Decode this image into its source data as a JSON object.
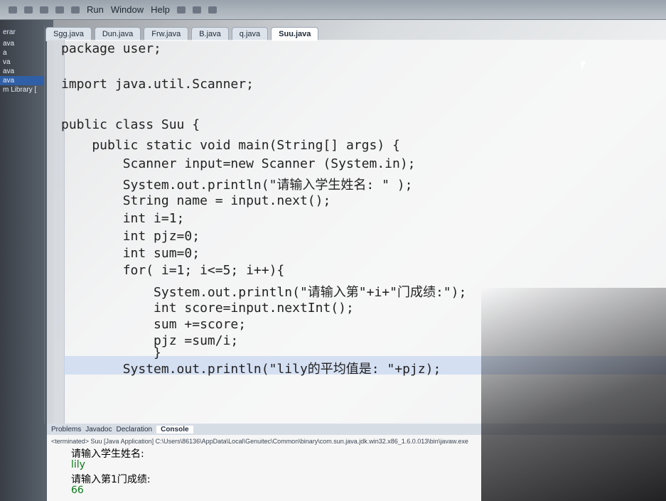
{
  "menus": [
    "Run",
    "Window",
    "Help"
  ],
  "tabs": [
    "Sgg.java",
    "Dun.java",
    "Frw.java",
    "B.java",
    "q.java",
    "Suu.java"
  ],
  "outline": {
    "title": "erar",
    "items": [
      "ava",
      "a",
      "va",
      "ava",
      "ava",
      "m Library ["
    ]
  },
  "code": [
    "package user;",
    "",
    "import java.util.Scanner;",
    "",
    "public class Suu {",
    "    public static void main(String[] args) {",
    "        Scanner input=new Scanner (System.in);",
    "        System.out.println(\"请输入学生姓名: \" );",
    "        String name = input.next();",
    "        int i=1;",
    "        int pjz=0;",
    "        int sum=0;",
    "        for( i=1; i<=5; i++){",
    "            System.out.println(\"请输入第\"+i+\"门成绩:\");",
    "            int score=input.nextInt();",
    "            sum +=score;",
    "            pjz =sum/i;",
    "            }",
    "        System.out.println(\"lily的平均值是: \"+pjz);"
  ],
  "console_tabs": [
    "Problems",
    "Javadoc",
    "Declaration",
    "Console"
  ],
  "console": {
    "terminated": "<terminated> Suu [Java Application] C:\\Users\\86136\\AppData\\Local\\Genuitec\\Common\\binary\\com.sun.java.jdk.win32.x86_1.6.0.013\\bin\\javaw.exe",
    "lines": [
      "请输入学生姓名:",
      "lily",
      "请输入第1门成绩:",
      "66"
    ]
  }
}
